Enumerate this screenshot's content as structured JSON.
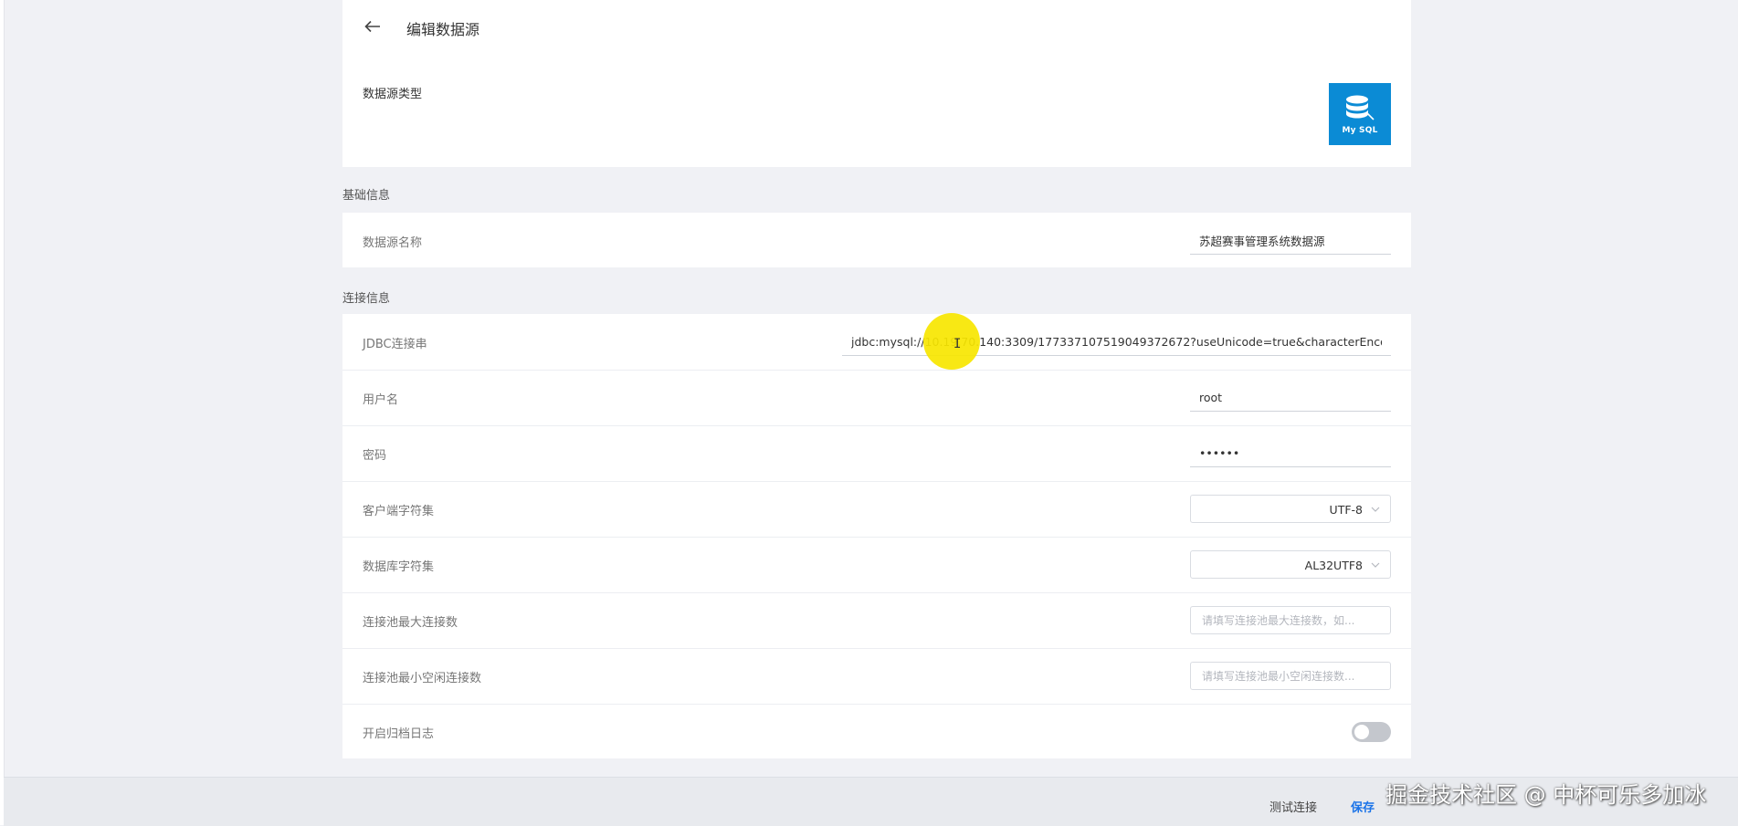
{
  "header": {
    "title": "编辑数据源"
  },
  "datasource_type": {
    "label": "数据源类型",
    "selected_logo_text": "My SQL"
  },
  "basic": {
    "section_title": "基础信息",
    "name_label": "数据源名称",
    "name_value": "苏超赛事管理系统数据源"
  },
  "connection": {
    "section_title": "连接信息",
    "jdbc_label": "JDBC连接串",
    "jdbc_value": "jdbc:mysql://10.19.70.140:3309/1773371075190493726​72?useUnicode=true&characterEncoding",
    "username_label": "用户名",
    "username_value": "root",
    "password_label": "密码",
    "password_value": "••••••",
    "client_charset_label": "客户端字符集",
    "client_charset_value": "UTF-8",
    "db_charset_label": "数据库字符集",
    "db_charset_value": "AL32UTF8",
    "pool_max_label": "连接池最大连接数",
    "pool_max_placeholder": "请填写连接池最大连接数，如...",
    "pool_min_label": "连接池最小空闲连接数",
    "pool_min_placeholder": "请填写连接池最小空闲连接数...",
    "archive_log_label": "开启归档日志",
    "archive_log_enabled": false
  },
  "footer": {
    "test_label": "测试连接",
    "save_label": "保存"
  },
  "watermark": "掘金技术社区 @ 中杯可乐多加冰",
  "colors": {
    "accent": "#1a73e8",
    "mysql_tile": "#0b8bd5",
    "cursor_highlight": "#f7e600"
  }
}
